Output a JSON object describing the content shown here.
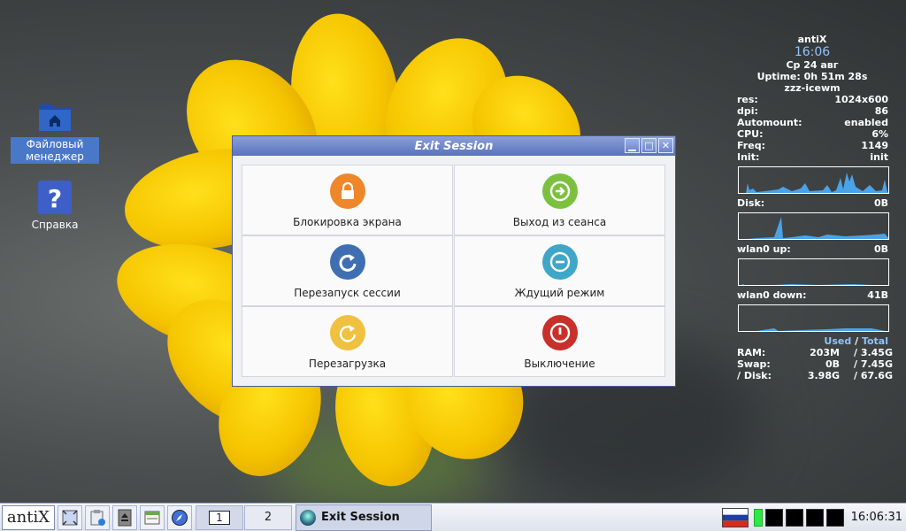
{
  "desktop": {
    "icons": [
      {
        "label": "Файловый менеджер"
      },
      {
        "label": "Справка"
      }
    ]
  },
  "conky": {
    "host": "antiX",
    "time": "16:06",
    "date": "Ср 24 авг",
    "uptime": "Uptime: 0h 51m 28s",
    "wm": "zzz-icewm",
    "stats": [
      {
        "k": "res:",
        "v": "1024x600"
      },
      {
        "k": "dpi:",
        "v": "86"
      },
      {
        "k": "Automount:",
        "v": "enabled"
      },
      {
        "k": "CPU:",
        "v": "6%"
      },
      {
        "k": "Freq:",
        "v": "1149"
      },
      {
        "k": "Init:",
        "v": "init"
      }
    ],
    "disk": {
      "k": "Disk:",
      "v": "0B"
    },
    "wlan_up": {
      "k": "wlan0 up:",
      "v": "0B"
    },
    "wlan_down": {
      "k": "wlan0 down:",
      "v": "41B"
    },
    "used_label": "Used",
    "slash": "/",
    "total_label": "Total",
    "mem": [
      {
        "k": "RAM:",
        "used": "203M",
        "total": "/ 3.45G"
      },
      {
        "k": "Swap:",
        "used": "0B",
        "total": "/ 7.45G"
      },
      {
        "k": "/ Disk:",
        "used": "3.98G",
        "total": "/ 67.6G"
      }
    ],
    "graph_color": "#4aa3e8"
  },
  "window": {
    "title": "Exit Session",
    "buttons": [
      {
        "label": "Блокировка экрана",
        "icon": "lock-icon",
        "color": "#f0862a"
      },
      {
        "label": "Выход из сеанса",
        "icon": "logout-icon",
        "color": "#7cc040"
      },
      {
        "label": "Перезапуск сессии",
        "icon": "restart-session-icon",
        "color": "#3f6fb2"
      },
      {
        "label": "Ждущий режим",
        "icon": "suspend-icon",
        "color": "#3fa6c8"
      },
      {
        "label": "Перезагрузка",
        "icon": "reboot-icon",
        "color": "#f0c040"
      },
      {
        "label": "Выключение",
        "icon": "power-icon",
        "color": "#c8302a"
      }
    ]
  },
  "taskbar": {
    "start_label": "antiX",
    "workspaces": [
      "1",
      "2"
    ],
    "task_label": "Exit Session",
    "clock": "16:06:31"
  }
}
